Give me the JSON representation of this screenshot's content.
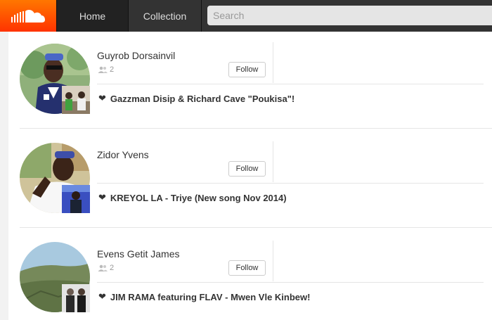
{
  "header": {
    "logo_icon": "soundcloud-cloud-icon",
    "accent": "#ff5500",
    "nav": {
      "home": "Home",
      "collection": "Collection"
    },
    "search": {
      "placeholder": "Search",
      "value": ""
    }
  },
  "suggestions": [
    {
      "name": "Guyrob Dorsainvil",
      "followers": "2",
      "follow_label": "Follow",
      "liked_track": "Gazzman Disip & Richard Cave \"Poukisa\"!",
      "avatar_colors": [
        "#7aa66a",
        "#2f3f8f",
        "#3a3a3a"
      ]
    },
    {
      "name": "Zidor Yvens",
      "followers": "",
      "follow_label": "Follow",
      "liked_track": "KREYOL LA - Triye (New song Nov 2014)",
      "avatar_colors": [
        "#c7b98a",
        "#f4f4f4",
        "#3a4cc8"
      ]
    },
    {
      "name": "Evens Getit James",
      "followers": "2",
      "follow_label": "Follow",
      "liked_track": "JIM RAMA featuring FLAV - Mwen Vle Kinbew!",
      "avatar_colors": [
        "#9cc0d8",
        "#6f7a52",
        "#555555"
      ]
    }
  ]
}
